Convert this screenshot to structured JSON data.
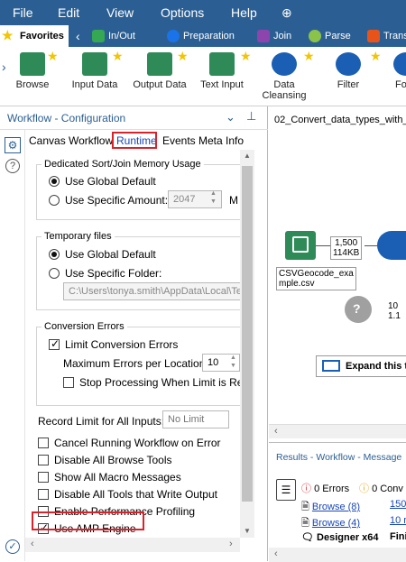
{
  "menu": {
    "file": "File",
    "edit": "Edit",
    "view": "View",
    "options": "Options",
    "help": "Help"
  },
  "categories": {
    "favorites": "Favorites",
    "inout": "In/Out",
    "preparation": "Preparation",
    "join": "Join",
    "parse": "Parse",
    "transform": "Trans"
  },
  "palette": {
    "browse": "Browse",
    "input": "Input Data",
    "output": "Output Data",
    "textinput": "Text Input",
    "cleansing_1": "Data",
    "cleansing_2": "Cleansing",
    "filter": "Filter",
    "formula": "Fo"
  },
  "config": {
    "title": "Workflow - Configuration",
    "tabs": {
      "canvas": "Canvas",
      "workflow": "Workflow",
      "runtime": "Runtime",
      "events": "Events",
      "meta": "Meta Info"
    },
    "memory": {
      "legend": "Dedicated Sort/Join Memory Usage",
      "global": "Use Global Default",
      "specific": "Use Specific Amount:",
      "amount": "2047",
      "unit": "M"
    },
    "temp": {
      "legend": "Temporary files",
      "global": "Use Global Default",
      "folder": "Use Specific Folder:",
      "path": "C:\\Users\\tonya.smith\\AppData\\Local\\Te"
    },
    "conv": {
      "legend": "Conversion Errors",
      "limit": "Limit Conversion Errors",
      "max_label": "Maximum Errors per Location:",
      "max_value": "10",
      "stop": "Stop Processing When Limit is Reach"
    },
    "record_limit_label": "Record Limit for All Inputs:",
    "record_limit_placeholder": "No Limit",
    "options": {
      "cancel": "Cancel Running Workflow on Error",
      "browse": "Disable All Browse Tools",
      "macro": "Show All Macro Messages",
      "write": "Disable All Tools that Write Output",
      "profiling": "Enable Performance Profiling",
      "amp": "Use AMP Engine"
    }
  },
  "canvas": {
    "title": "02_Convert_data_types_with_",
    "conn_1": "1,500",
    "conn_2": "114KB",
    "node_label_1": "CSVGeocode_exa",
    "node_label_2": "mple.csv",
    "conn_3": "10",
    "conn_4": "1.1",
    "expand": "Expand this t"
  },
  "results": {
    "title": "Results - Workflow - Message",
    "errors": "0 Errors",
    "conv": "0 Conv",
    "rows": [
      {
        "name": "Browse (8)",
        "value": "150"
      },
      {
        "name": "Browse (4)",
        "value": "10 r"
      },
      {
        "name": "Designer x64",
        "value": "Fini"
      }
    ]
  },
  "colors": {
    "header_blue": "#2b5f93",
    "highlight_red": "#d9232a",
    "link_blue": "#1a47b8"
  }
}
